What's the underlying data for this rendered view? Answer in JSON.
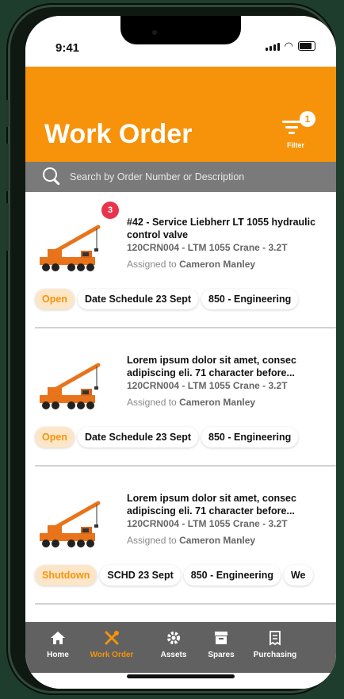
{
  "status_bar": {
    "time": "9:41"
  },
  "header": {
    "title": "Work Order",
    "filter_label": "Filter",
    "filter_count": "1"
  },
  "search": {
    "placeholder": "Search by Order Number or Description"
  },
  "work_orders": [
    {
      "badge": "3",
      "title": "#42 - Service Liebherr LT 1055 hydraulic control valve",
      "asset": "120CRN004 - LTM 1055 Crane - 3.2T",
      "assigned_prefix": "Assigned to",
      "assignee": "Cameron Manley",
      "chips": [
        "Open",
        "Date Schedule 23 Sept",
        "850 - Engineering"
      ]
    },
    {
      "badge": "",
      "title": "Lorem ipsum dolor sit amet, consec adipiscing eli. 71 character before...",
      "asset": "120CRN004 - LTM 1055 Crane - 3.2T",
      "assigned_prefix": "Assigned to",
      "assignee": "Cameron Manley",
      "chips": [
        "Open",
        "Date Schedule 23 Sept",
        "850 - Engineering"
      ]
    },
    {
      "badge": "",
      "title": "Lorem ipsum dolor sit amet, consec adipiscing eli. 71 character before...",
      "asset": "120CRN004 - LTM 1055 Crane - 3.2T",
      "assigned_prefix": "Assigned to",
      "assignee": "Cameron Manley",
      "chips": [
        "Shutdown",
        "SCHD 23 Sept",
        "850 - Engineering",
        "We"
      ]
    }
  ],
  "tabs": [
    {
      "label": "Home",
      "icon": "home-icon"
    },
    {
      "label": "Work Order",
      "icon": "tools-icon"
    },
    {
      "label": "Assets",
      "icon": "gear-icon"
    },
    {
      "label": "Spares",
      "icon": "archive-box-icon"
    },
    {
      "label": "Purchasing",
      "icon": "receipt-icon"
    }
  ],
  "active_tab": "Work Order",
  "colors": {
    "brand": "#f7930a",
    "badge": "#e8354d",
    "search_bar": "#7a7a7a",
    "tab_bar": "#616161"
  }
}
